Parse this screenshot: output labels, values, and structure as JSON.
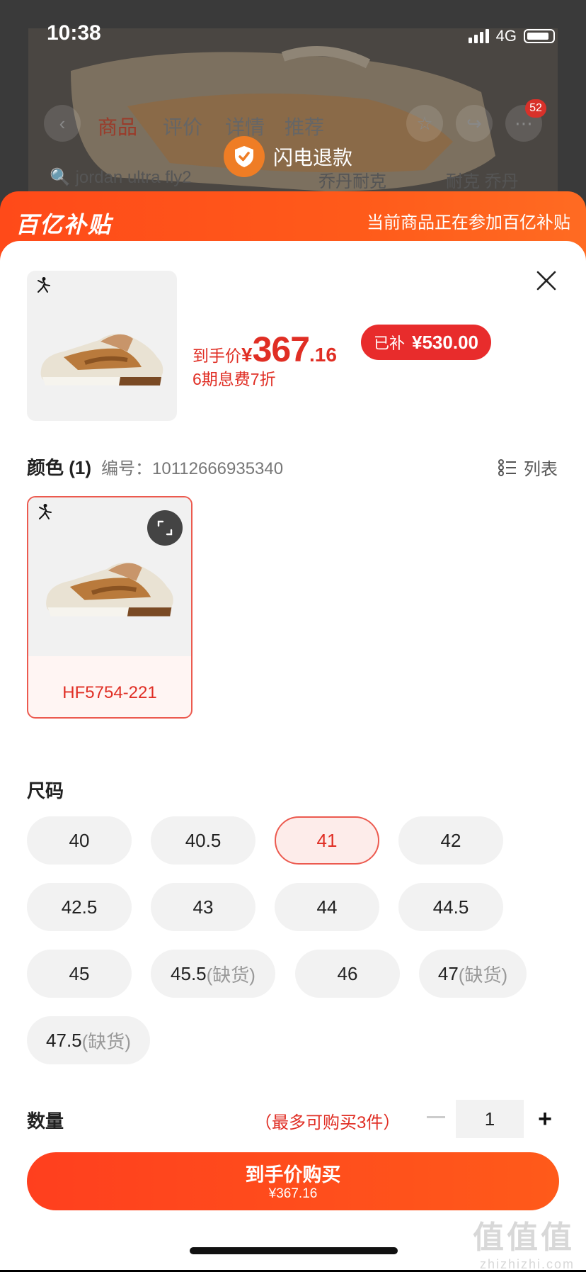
{
  "status_bar": {
    "time": "10:38",
    "network": "4G"
  },
  "background_page": {
    "tabs": [
      "商品",
      "评价",
      "详情",
      "推荐"
    ],
    "badge_count": "52",
    "toast": "闪电退款",
    "search_hint": "jordan ultra fly2",
    "search_tags": [
      "乔丹耐克",
      "耐克 乔丹"
    ]
  },
  "banner": {
    "logo": "百亿补贴",
    "message": "当前商品正在参加百亿补贴"
  },
  "product": {
    "price_label": "到手价",
    "currency": "¥",
    "price_int": "367",
    "price_dec": ".16",
    "subsidy_label": "已补",
    "subsidy_amount": "¥530.00",
    "installment": "6期息费7折"
  },
  "color_section": {
    "title": "颜色 (1)",
    "code_label": "编号：",
    "code": "10112666935340",
    "list_label": "列表",
    "options": [
      {
        "label": "HF5754-221"
      }
    ]
  },
  "size_section": {
    "title": "尺码",
    "options": [
      {
        "label": "40",
        "oos": ""
      },
      {
        "label": "40.5",
        "oos": ""
      },
      {
        "label": "41",
        "oos": "",
        "selected": true
      },
      {
        "label": "42",
        "oos": ""
      },
      {
        "label": "42.5",
        "oos": ""
      },
      {
        "label": "43",
        "oos": ""
      },
      {
        "label": "44",
        "oos": ""
      },
      {
        "label": "44.5",
        "oos": ""
      },
      {
        "label": "45",
        "oos": ""
      },
      {
        "label": "45.5",
        "oos": "(缺货)"
      },
      {
        "label": "46",
        "oos": ""
      },
      {
        "label": "47",
        "oos": "(缺货)"
      },
      {
        "label": "47.5",
        "oos": "(缺货)"
      }
    ]
  },
  "quantity": {
    "title": "数量",
    "limit": "（最多可购买3件）",
    "value": "1",
    "minus": "−",
    "plus": "+"
  },
  "buy_button": {
    "label": "到手价购买",
    "price": "¥367.16"
  },
  "watermark": {
    "text": "值值值",
    "url": "zhizhizhi.com"
  },
  "colors": {
    "accent": "#e02e24",
    "banner": "#ff4a19"
  }
}
